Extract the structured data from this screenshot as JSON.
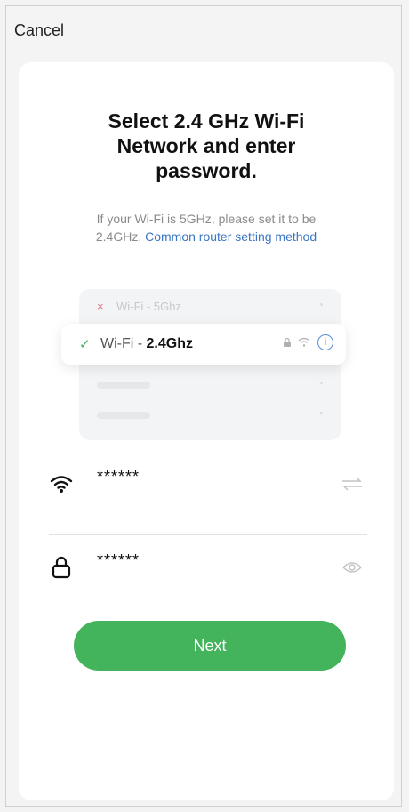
{
  "header": {
    "cancel_label": "Cancel"
  },
  "title": {
    "line1": "Select 2.4 GHz Wi-Fi",
    "line2": "Network and enter",
    "line3": "password."
  },
  "hint": {
    "line1": "If your Wi-Fi is 5GHz, please set it to be",
    "line2_prefix": "2.4GHz. ",
    "link_text": "Common router setting method"
  },
  "illustration": {
    "bad_network_mark": "×",
    "bad_network_label": "Wi-Fi - 5Ghz",
    "good_network_mark": "✓",
    "good_network_prefix": "Wi-Fi - ",
    "good_network_band": "2.4Ghz"
  },
  "wifi_field": {
    "value": "******"
  },
  "password_field": {
    "value": "******"
  },
  "next_button": {
    "label": "Next"
  },
  "colors": {
    "accent_green": "#43b35c",
    "link_blue": "#3b76c4",
    "error_pink": "#e06a82"
  }
}
